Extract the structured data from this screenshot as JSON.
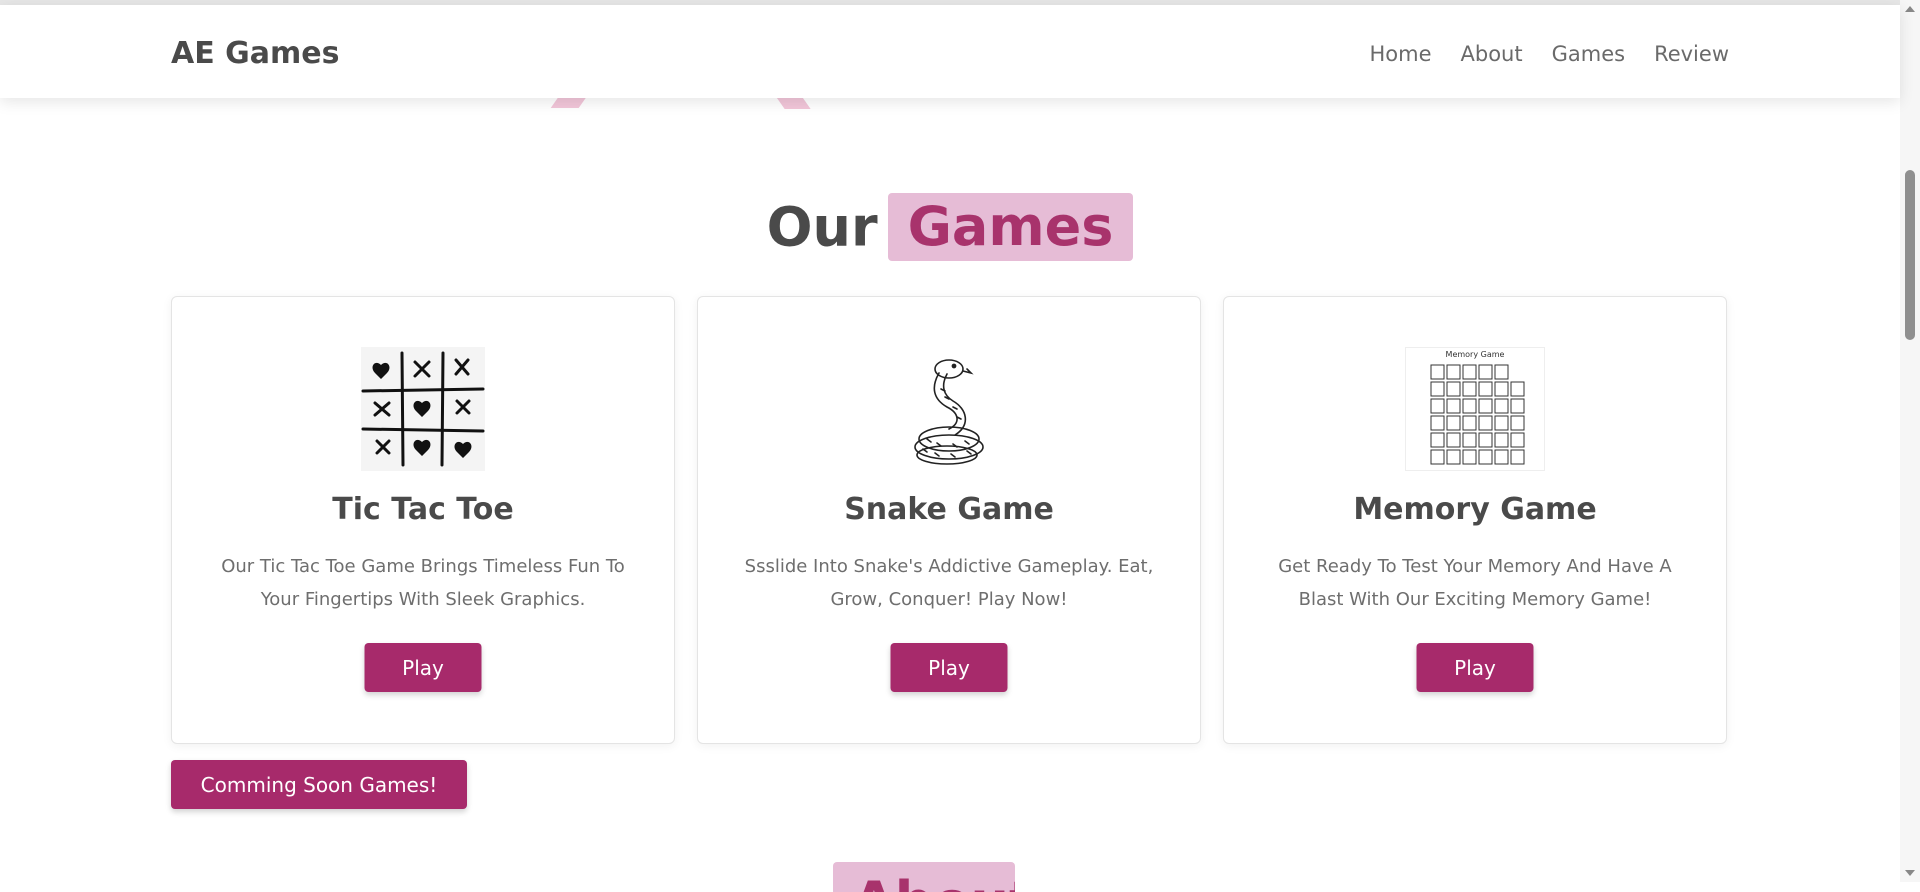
{
  "brand": "AE Games",
  "nav": [
    "Home",
    "About",
    "Games",
    "Review"
  ],
  "section": {
    "title_plain": "Our",
    "title_highlight": "Games"
  },
  "games": [
    {
      "title": "Tic Tac Toe",
      "description": "Our Tic Tac Toe Game Brings Timeless Fun To Your Fingertips With Sleek Graphics.",
      "button": "Play",
      "icon": "tic-tac-toe-icon"
    },
    {
      "title": "Snake Game",
      "description": "Ssslide Into Snake's Addictive Gameplay. Eat, Grow, Conquer! Play Now!",
      "button": "Play",
      "icon": "snake-icon"
    },
    {
      "title": "Memory Game",
      "description": "Get Ready To Test Your Memory And Have A Blast With Our Exciting Memory Game!",
      "button": "Play",
      "icon": "memory-grid-icon",
      "thumb_caption": "Memory Game"
    }
  ],
  "coming_soon_label": "Comming Soon Games!",
  "next_section_title_highlight": "About",
  "colors": {
    "accent": "#a72a6b",
    "highlight_bg": "#e6bcd6",
    "highlight_text": "#a8336c",
    "heading": "#4a4a4a",
    "body_text": "#6e6e6e"
  }
}
